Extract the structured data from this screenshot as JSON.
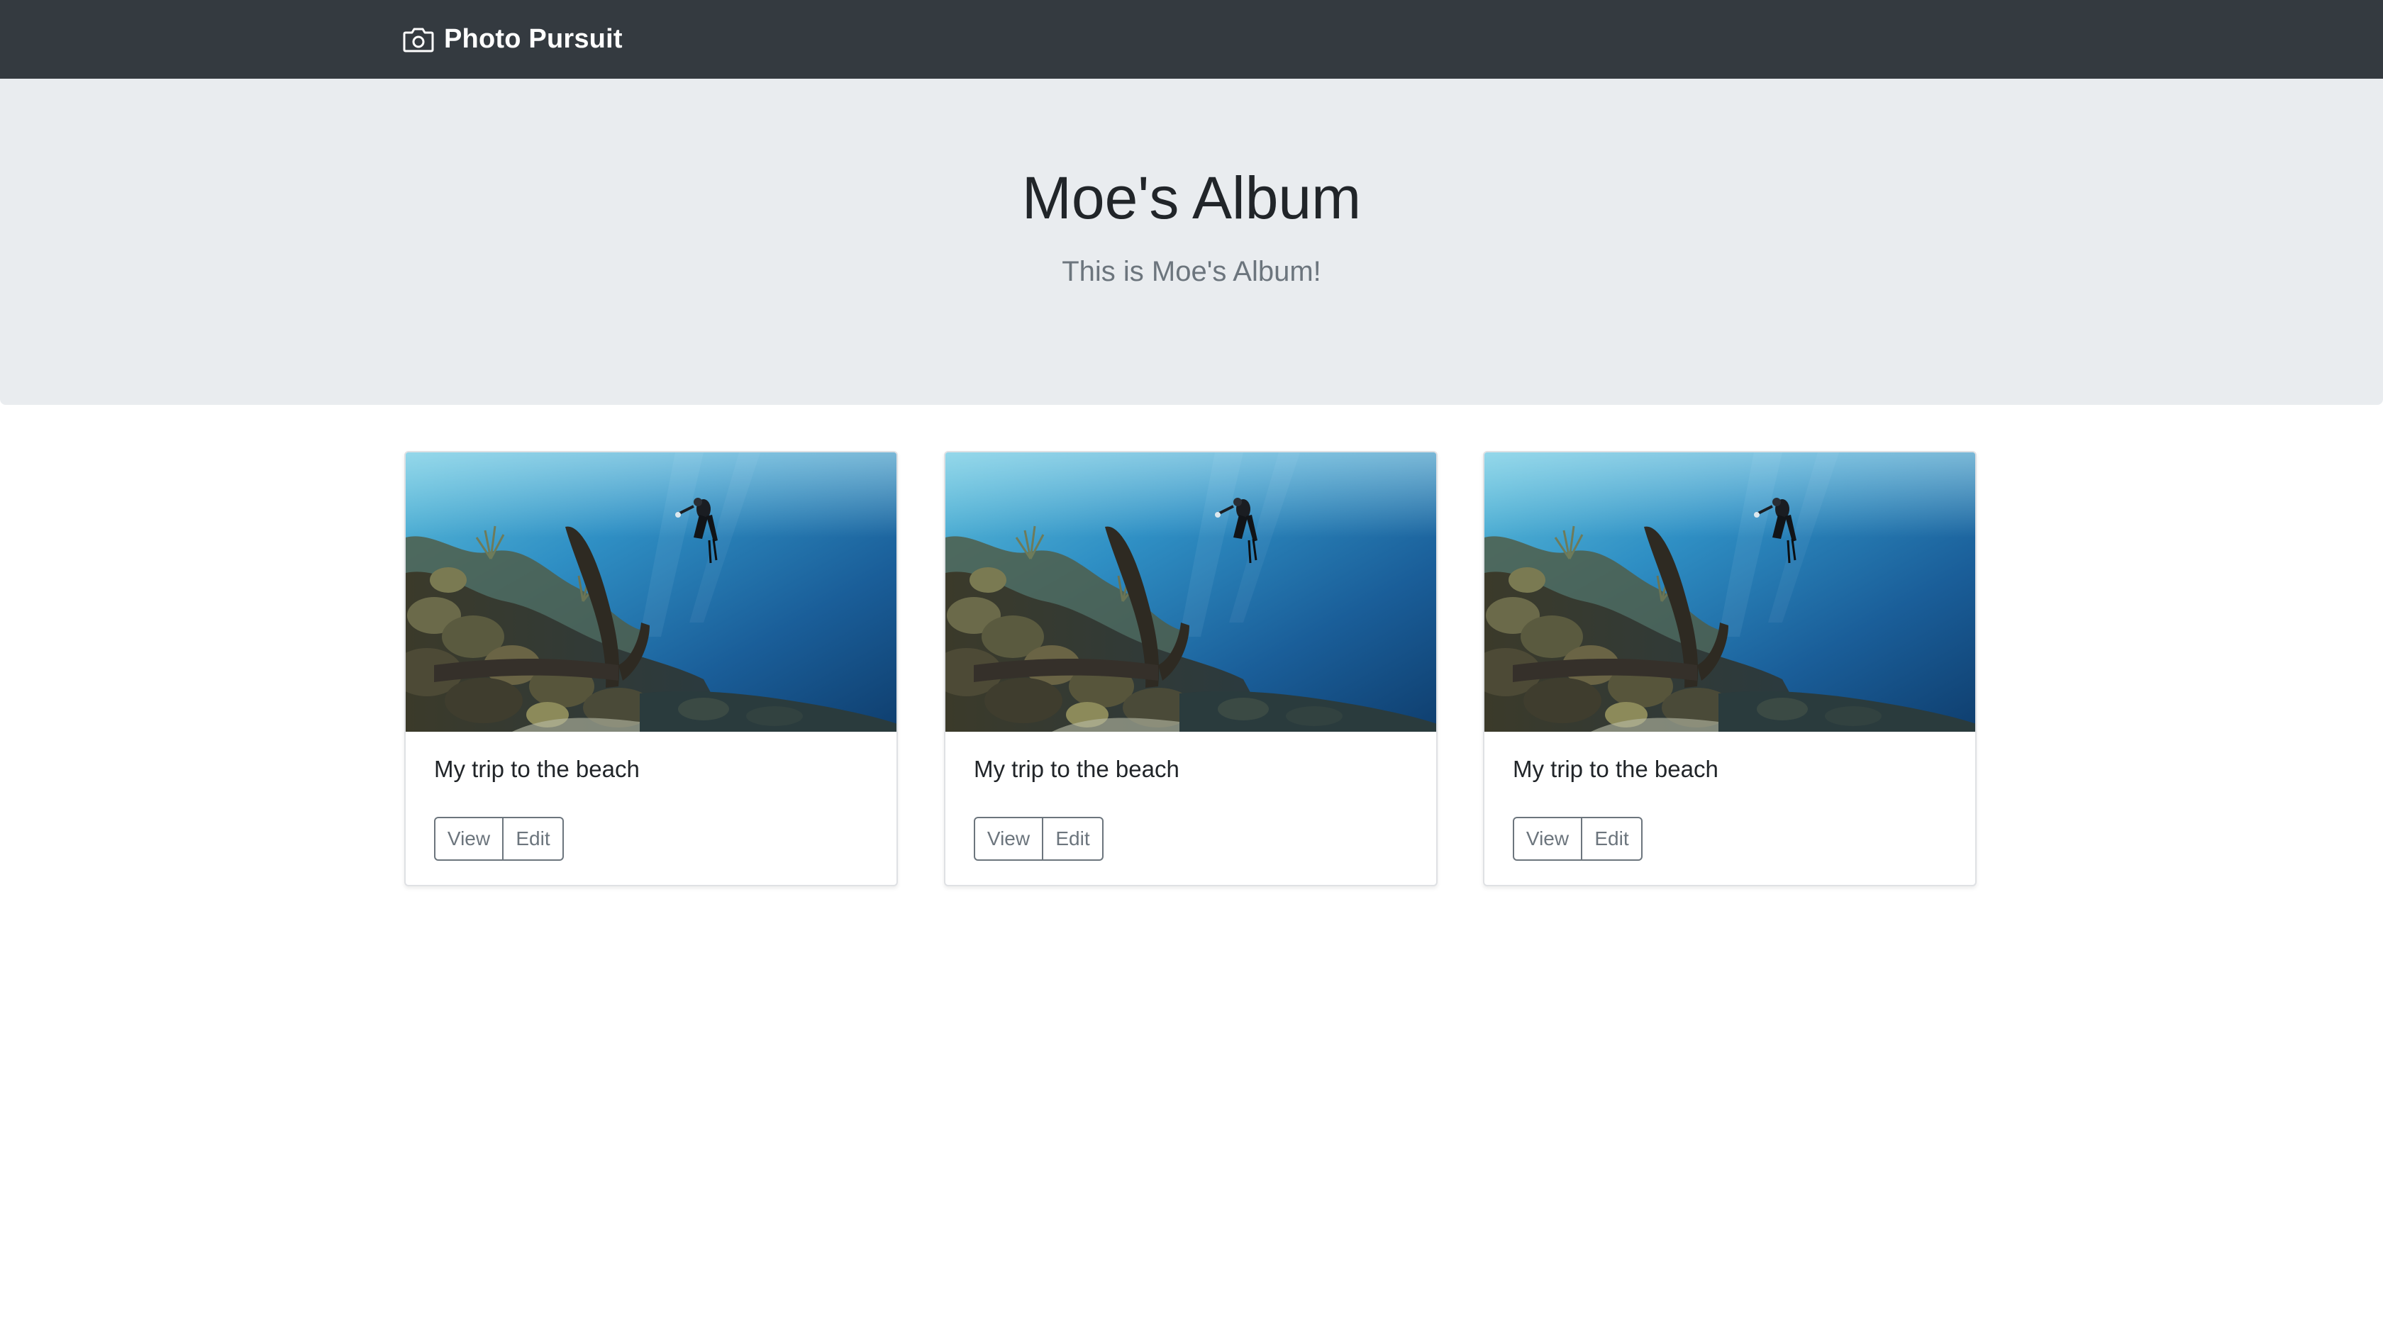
{
  "navbar": {
    "brand_icon": "camera-icon",
    "brand_text": "Photo Pursuit"
  },
  "jumbotron": {
    "title": "Moe's Album",
    "lead": "This is Moe's Album!"
  },
  "cards": [
    {
      "image": "underwater-anchor-diver-photo",
      "text": "My trip to the beach",
      "view_label": "View",
      "edit_label": "Edit"
    },
    {
      "image": "underwater-anchor-diver-photo",
      "text": "My trip to the beach",
      "view_label": "View",
      "edit_label": "Edit"
    },
    {
      "image": "underwater-anchor-diver-photo",
      "text": "My trip to the beach",
      "view_label": "View",
      "edit_label": "Edit"
    }
  ],
  "colors": {
    "navbar_bg": "#343a40",
    "jumbotron_bg": "#e9ecef",
    "button_outline": "#6c757d"
  }
}
